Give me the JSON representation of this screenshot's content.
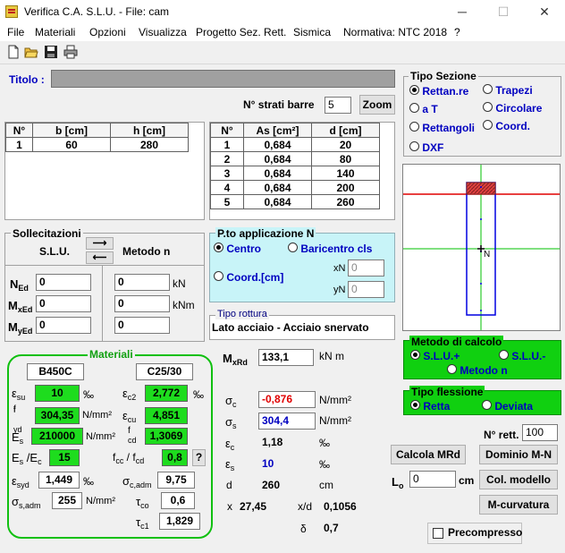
{
  "window": {
    "title": "Verifica C.A. S.L.U. - File: cam",
    "min": "─",
    "max": "☐",
    "close": "✕"
  },
  "menu": [
    "File",
    "Materiali",
    "Opzioni",
    "Visualizza",
    "Progetto Sez. Rett.",
    "Sismica",
    "Normativa: NTC 2018",
    "?"
  ],
  "titolo": {
    "label": "Titolo :",
    "value": ""
  },
  "strati": {
    "label": "N° strati barre",
    "value": "5",
    "zoom": "Zoom"
  },
  "section_table": {
    "headers": [
      "N°",
      "b [cm]",
      "h [cm]"
    ],
    "rows": [
      [
        "1",
        "60",
        "280"
      ]
    ]
  },
  "bars_table": {
    "headers": [
      "N°",
      "As [cm²]",
      "d [cm]"
    ],
    "rows": [
      [
        "1",
        "0,684",
        "20"
      ],
      [
        "2",
        "0,684",
        "80"
      ],
      [
        "3",
        "0,684",
        "140"
      ],
      [
        "4",
        "0,684",
        "200"
      ],
      [
        "5",
        "0,684",
        "260"
      ]
    ]
  },
  "tipo_sezione": {
    "title": "Tipo Sezione",
    "options": [
      "Rettan.re",
      "Trapezi",
      "a T",
      "Circolare",
      "Rettangoli",
      "Coord.",
      "DXF"
    ],
    "selected": "Rettan.re"
  },
  "sollecitazioni": {
    "title": "Sollecitazioni",
    "slu": "S.L.U.",
    "metodo": "Metodo n",
    "ned": "0",
    "mxed": "0",
    "myed": "0",
    "n2": "0",
    "mx2": "0",
    "my2": "0",
    "unit_kn": "kN",
    "unit_knm": "kNm"
  },
  "pto_applicazione": {
    "title": "P.to applicazione N",
    "centro": "Centro",
    "baricentro": "Baricentro cls",
    "coord": "Coord.[cm]",
    "xn_label": "xN",
    "yn_label": "yN",
    "xn": "0",
    "yn": "0"
  },
  "tipo_rottura": {
    "title": "Tipo rottura",
    "value": "Lato acciaio - Acciaio snervato"
  },
  "materiali": {
    "title": "Materiali",
    "steel": "B450C",
    "concrete": "C25/30",
    "esu": "10",
    "esu_unit": "‰",
    "ec2": "2,772",
    "ec2_unit": "‰",
    "fyd": "304,35",
    "fyd_unit": "N/mm²",
    "ecu": "4,851",
    "es": "210000",
    "es_unit": "N/mm²",
    "fcd": "1,3069",
    "esec": "15",
    "fccfcd": "0,8",
    "q": "?",
    "esyd": "1,449",
    "esyd_unit": "‰",
    "sc_adm": "9,75",
    "ss_adm": "255",
    "ss_adm_unit": "N/mm²",
    "tco": "0,6",
    "tc1": "1,829"
  },
  "results": {
    "mxrd": "133,1",
    "mxrd_unit": "kN m",
    "sc": "-0,876",
    "sc_unit": "N/mm²",
    "ss": "304,4",
    "ss_unit": "N/mm²",
    "ec": "1,18",
    "ec_unit": "‰",
    "es": "10",
    "es_unit": "‰",
    "d_label": "d",
    "d": "260",
    "d_unit": "cm",
    "x_label": "x",
    "x": "27,45",
    "xd_label": "x/d",
    "xd": "0,1056",
    "delta_label": "δ",
    "delta": "0,7"
  },
  "metodo_calcolo": {
    "title": "Metodo di calcolo",
    "options": [
      "S.L.U.+",
      "S.L.U.-",
      "Metodo n"
    ],
    "selected": "S.L.U.+"
  },
  "tipo_flessione": {
    "title": "Tipo flessione",
    "options": [
      "Retta",
      "Deviata"
    ],
    "selected": "Retta"
  },
  "nrett": {
    "label": "N° rett.",
    "value": "100"
  },
  "buttons": {
    "calcola": "Calcola MRd",
    "dominio": "Dominio M-N",
    "colmodello": "Col. modello",
    "mcurvatura": "M-curvatura"
  },
  "lo": {
    "label": "L",
    "value": "0",
    "unit": "cm"
  },
  "precompresso": "Precompresso",
  "colors": {
    "green": "#1edc1e",
    "panel_cyan": "#c8f4f8",
    "panel_green": "#10d010",
    "red_line": "#e00000",
    "axis_green": "#00c000"
  }
}
